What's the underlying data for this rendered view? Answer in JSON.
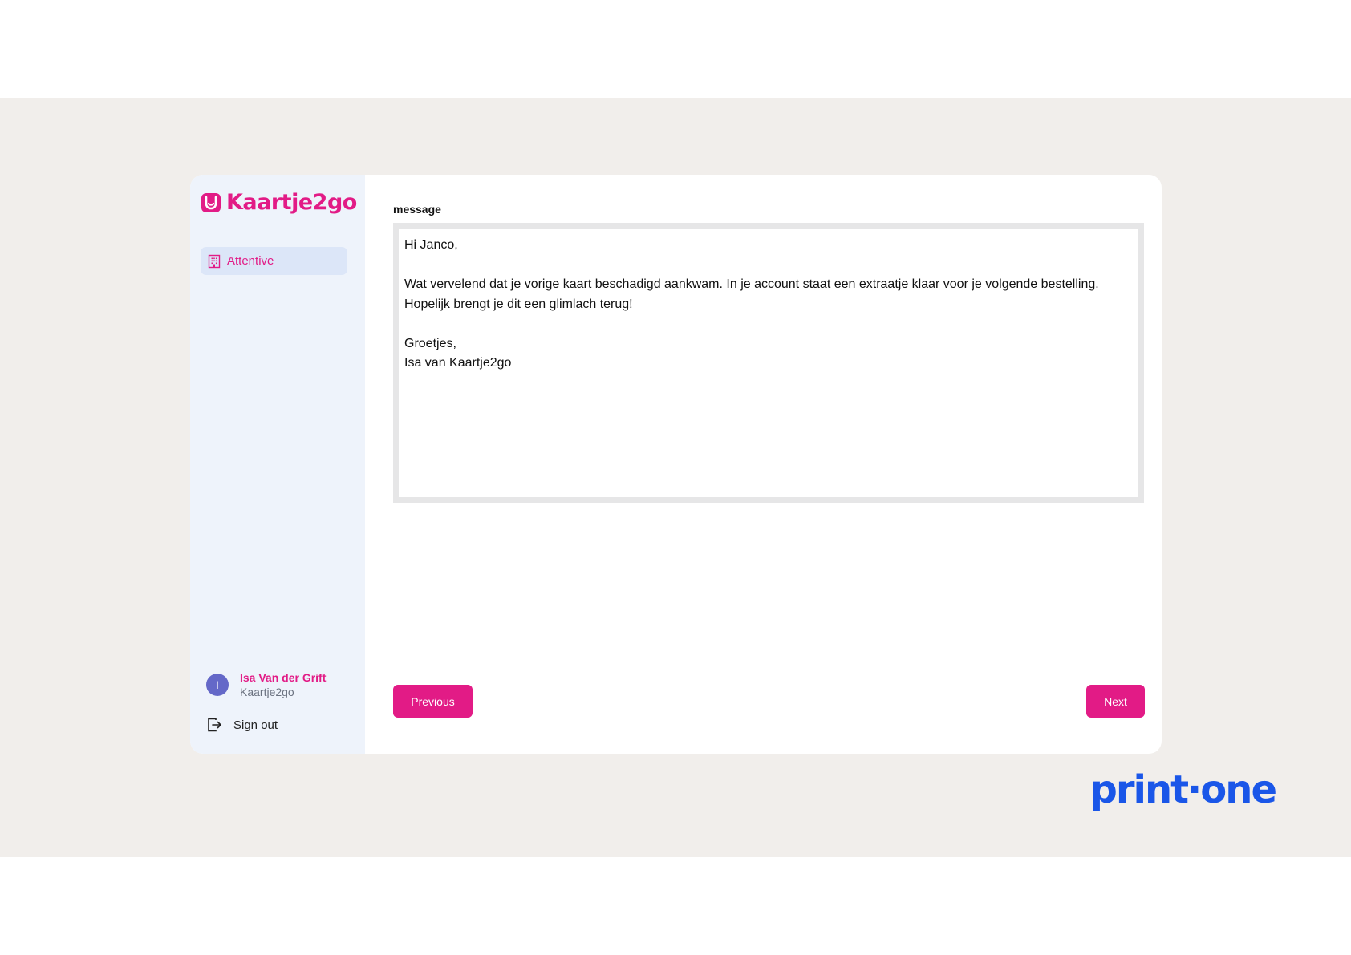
{
  "sidebar": {
    "logo_text": "Kaartje2go",
    "logo_icon": "kaartje2go-logo-icon",
    "nav_items": [
      {
        "label": "Attentive",
        "icon": "building-icon"
      }
    ],
    "user": {
      "initial": "I",
      "name": "Isa Van der Grift",
      "org": "Kaartje2go"
    },
    "sign_out_label": "Sign out"
  },
  "main": {
    "field_label": "message",
    "message_value": "Hi Janco,\n\nWat vervelend dat je vorige kaart beschadigd aankwam. In je account staat een extraatje klaar voor je volgende bestelling. Hopelijk brengt je dit een glimlach terug!\n\nGroetjes,\nIsa van Kaartje2go",
    "previous_label": "Previous",
    "next_label": "Next"
  },
  "brand": {
    "text": "print·one"
  },
  "colors": {
    "accent": "#e21b86",
    "brand_blue": "#1a56e8",
    "stage_background": "#f1eeeb",
    "sidebar_background": "#eef3fb",
    "nav_active_background": "#dce6f8",
    "avatar": "#6468c8"
  }
}
